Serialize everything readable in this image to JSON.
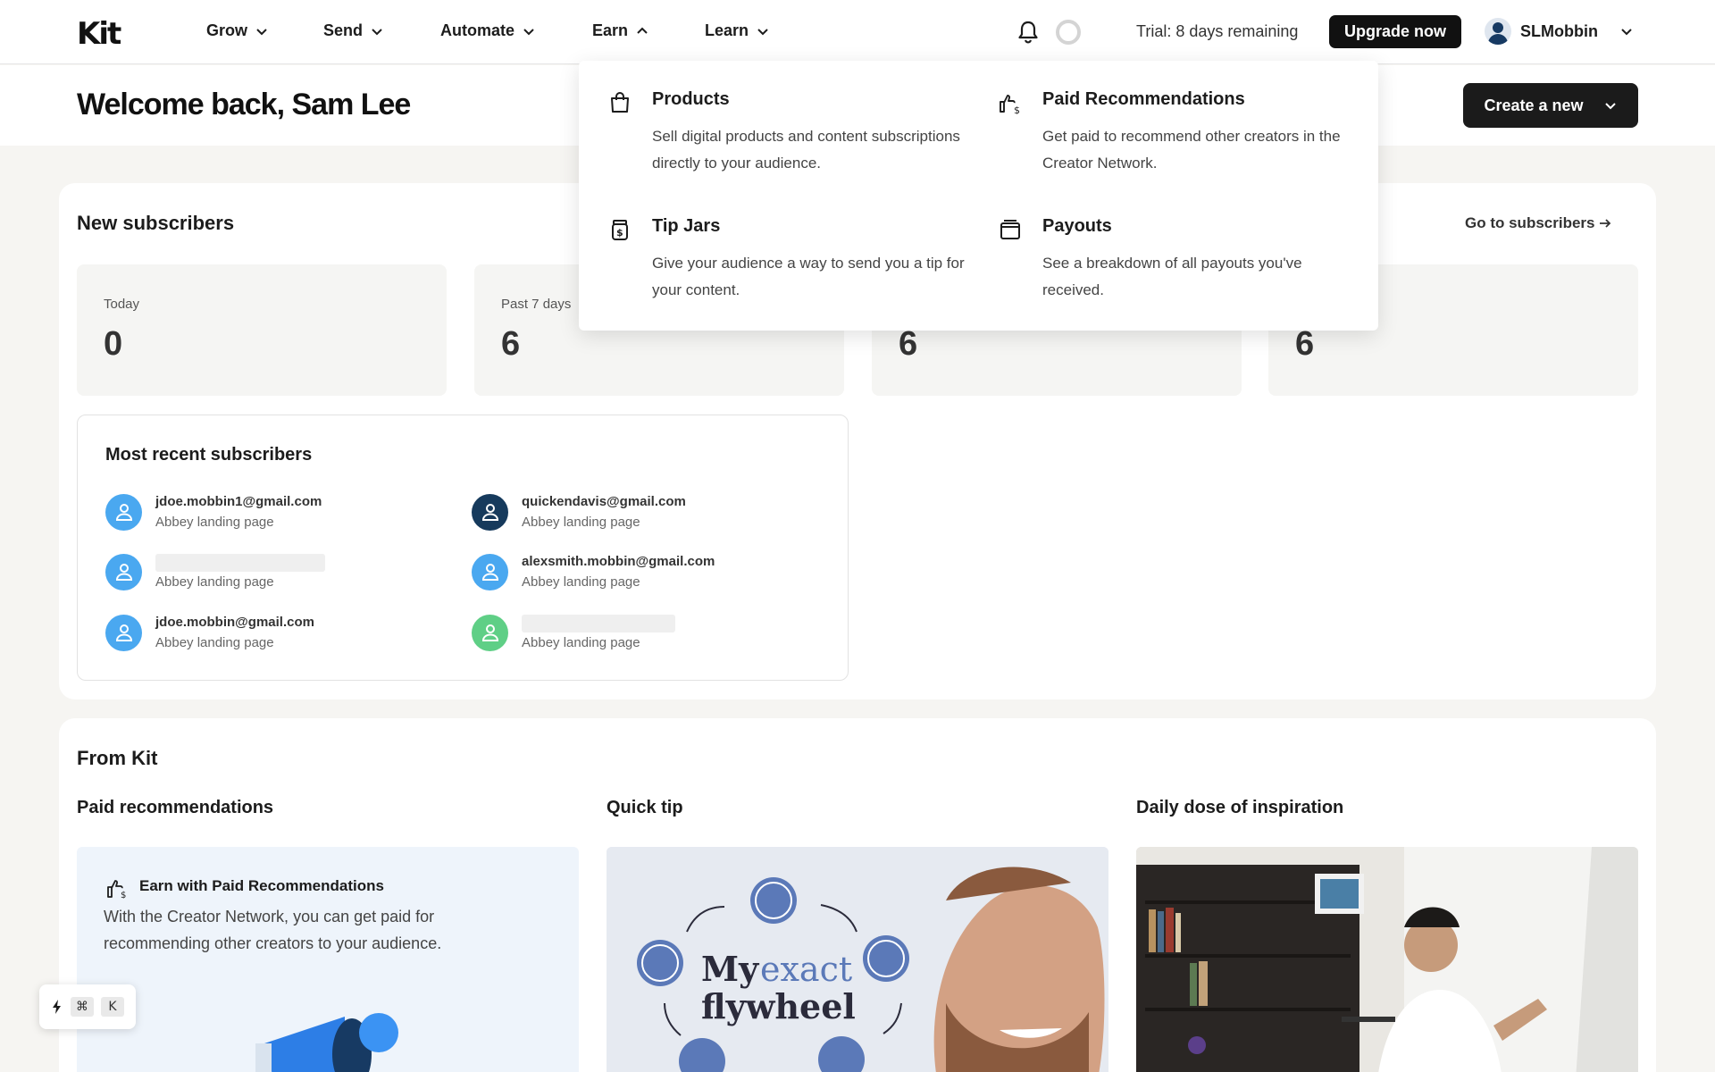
{
  "app": {
    "logo": "Kit"
  },
  "nav": {
    "items": [
      {
        "label": "Grow",
        "expanded": false
      },
      {
        "label": "Send",
        "expanded": false
      },
      {
        "label": "Automate",
        "expanded": false
      },
      {
        "label": "Earn",
        "expanded": true
      },
      {
        "label": "Learn",
        "expanded": false
      }
    ],
    "trial": "Trial: 8 days remaining",
    "upgrade_label": "Upgrade now",
    "username": "SLMobbin"
  },
  "header": {
    "welcome": "Welcome back, Sam Lee",
    "create_label": "Create a new"
  },
  "earn_menu": [
    {
      "title": "Products",
      "desc": "Sell digital products and content subscriptions directly to your audience.",
      "icon": "shopping-bag-icon"
    },
    {
      "title": "Paid Recommendations",
      "desc": "Get paid to recommend other creators in the Creator Network.",
      "icon": "thumbs-up-dollar-icon"
    },
    {
      "title": "Tip Jars",
      "desc": "Give your audience a way to send you a tip for your content.",
      "icon": "tip-jar-icon"
    },
    {
      "title": "Payouts",
      "desc": "See a breakdown of all payouts you've received.",
      "icon": "wallet-icon"
    }
  ],
  "subscribers": {
    "title": "New subscribers",
    "goto_label": "Go to subscribers",
    "stats": [
      {
        "label": "Today",
        "value": "0"
      },
      {
        "label": "Past 7 days",
        "value": "6"
      },
      {
        "label": "",
        "value": "6"
      },
      {
        "label": "",
        "value": "6"
      }
    ],
    "recent_title": "Most recent subscribers",
    "recent": [
      {
        "email": "jdoe.mobbin1@gmail.com",
        "source": "Abbey landing page",
        "color": "#4aa8f0"
      },
      {
        "email": "quickendavis@gmail.com",
        "source": "Abbey landing page",
        "color": "#163a5c"
      },
      {
        "email": "",
        "source": "Abbey landing page",
        "color": "#4aa8f0"
      },
      {
        "email": "alexsmith.mobbin@gmail.com",
        "source": "Abbey landing page",
        "color": "#4aa8f0"
      },
      {
        "email": "jdoe.mobbin@gmail.com",
        "source": "Abbey landing page",
        "color": "#4aa8f0"
      },
      {
        "email": "",
        "source": "Abbey landing page",
        "color": "#5fcf86"
      }
    ]
  },
  "from_kit": {
    "title": "From Kit",
    "columns": [
      "Paid recommendations",
      "Quick tip",
      "Daily dose of inspiration"
    ],
    "promo_title": "Earn with Paid Recommendations",
    "promo_text": "With the Creator Network, you can get paid for recommending other creators to your audience.",
    "tip_title_line1": "My",
    "tip_title_line1b": "exact",
    "tip_title_line2": "flywheel"
  },
  "cmd_hint": {
    "keys": [
      "⌘",
      "K"
    ]
  }
}
